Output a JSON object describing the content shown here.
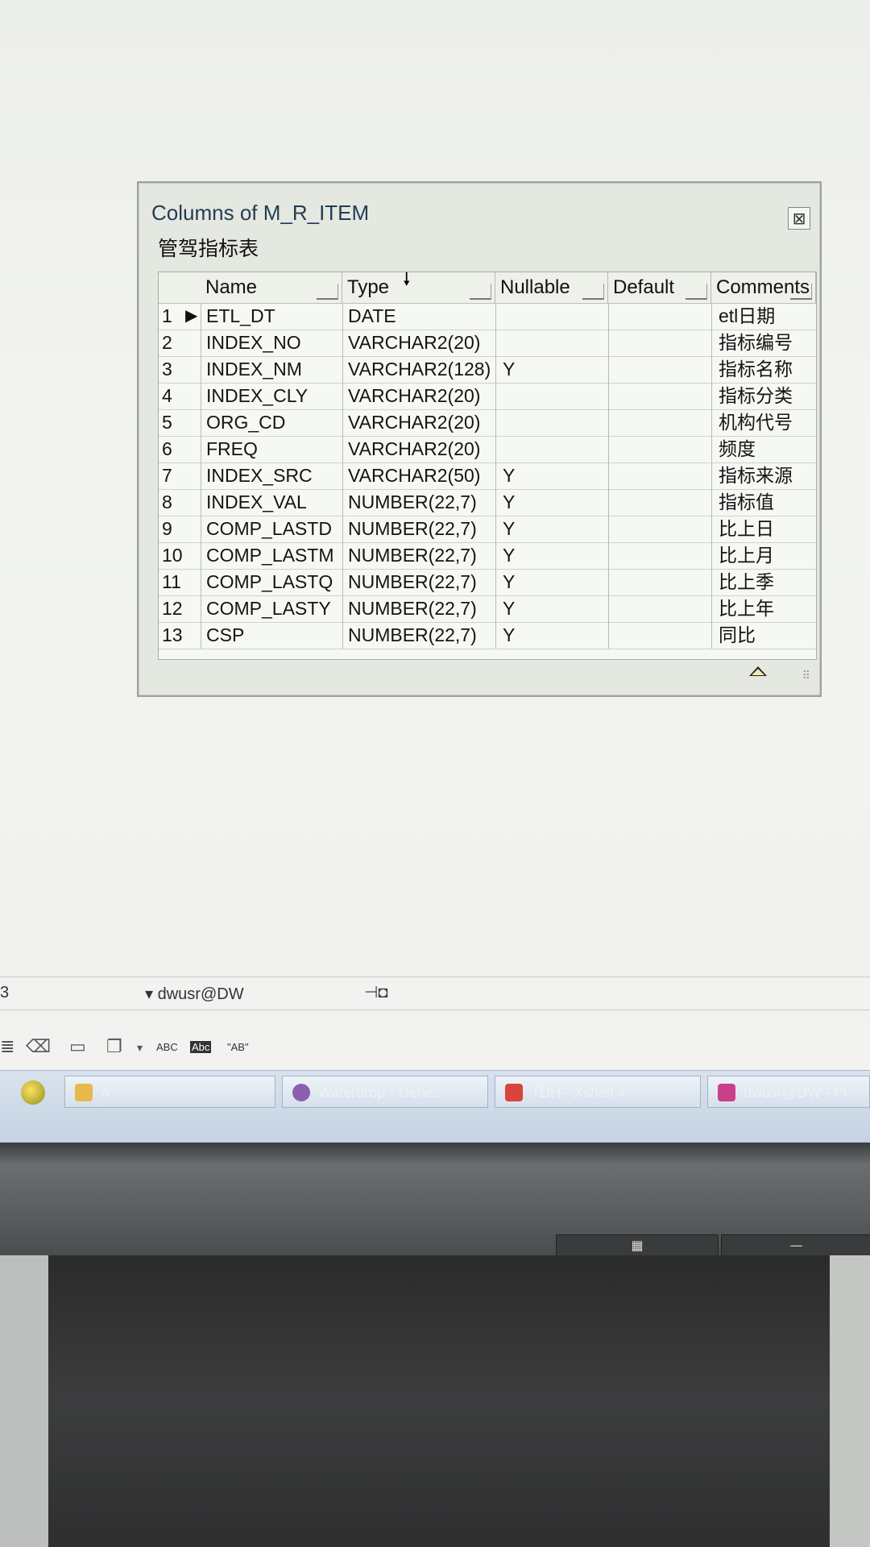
{
  "popup": {
    "title": "Columns of M_R_ITEM",
    "subtitle": "管驾指标表",
    "close_icon": "close-icon"
  },
  "grid": {
    "headers": [
      "Name",
      "Type",
      "Nullable",
      "Default",
      "Comments"
    ],
    "rows": [
      {
        "num": "1",
        "name": "ETL_DT",
        "type": "DATE",
        "nullable": "",
        "default": "",
        "comments": "etl日期"
      },
      {
        "num": "2",
        "name": "INDEX_NO",
        "type": "VARCHAR2(20)",
        "nullable": "",
        "default": "",
        "comments": "指标编号"
      },
      {
        "num": "3",
        "name": "INDEX_NM",
        "type": "VARCHAR2(128)",
        "nullable": "Y",
        "default": "",
        "comments": "指标名称"
      },
      {
        "num": "4",
        "name": "INDEX_CLY",
        "type": "VARCHAR2(20)",
        "nullable": "",
        "default": "",
        "comments": "指标分类"
      },
      {
        "num": "5",
        "name": "ORG_CD",
        "type": "VARCHAR2(20)",
        "nullable": "",
        "default": "",
        "comments": "机构代号"
      },
      {
        "num": "6",
        "name": "FREQ",
        "type": "VARCHAR2(20)",
        "nullable": "",
        "default": "",
        "comments": "频度"
      },
      {
        "num": "7",
        "name": "INDEX_SRC",
        "type": "VARCHAR2(50)",
        "nullable": "Y",
        "default": "",
        "comments": "指标来源"
      },
      {
        "num": "8",
        "name": "INDEX_VAL",
        "type": "NUMBER(22,7)",
        "nullable": "Y",
        "default": "",
        "comments": "指标值"
      },
      {
        "num": "9",
        "name": "COMP_LASTD",
        "type": "NUMBER(22,7)",
        "nullable": "Y",
        "default": "",
        "comments": "比上日"
      },
      {
        "num": "10",
        "name": "COMP_LASTM",
        "type": "NUMBER(22,7)",
        "nullable": "Y",
        "default": "",
        "comments": "比上月"
      },
      {
        "num": "11",
        "name": "COMP_LASTQ",
        "type": "NUMBER(22,7)",
        "nullable": "Y",
        "default": "",
        "comments": "比上季"
      },
      {
        "num": "12",
        "name": "COMP_LASTY",
        "type": "NUMBER(22,7)",
        "nullable": "Y",
        "default": "",
        "comments": "比上年"
      },
      {
        "num": "13",
        "name": "CSP",
        "type": "NUMBER(22,7)",
        "nullable": "Y",
        "default": "",
        "comments": "同比"
      }
    ]
  },
  "statusbar": {
    "line": "3",
    "connection": "dwusr@DW"
  },
  "toolbar": {
    "abc_label": "ABC",
    "abc2_label": "Abc",
    "ab_label": "\"AB\""
  },
  "taskbar": {
    "items": [
      {
        "label": "A",
        "icon": "folder-icon",
        "color": "#e6b94a"
      },
      {
        "label": "Waterdrop - Gene...",
        "icon": "waterdrop-icon",
        "color": "#8a5fb0"
      },
      {
        "label": "TDH - Xshell 4",
        "icon": "xshell-icon",
        "color": "#d9443a"
      },
      {
        "label": "dwusr@DW - Pl",
        "icon": "plsql-icon",
        "color": "#c9408a"
      }
    ]
  }
}
